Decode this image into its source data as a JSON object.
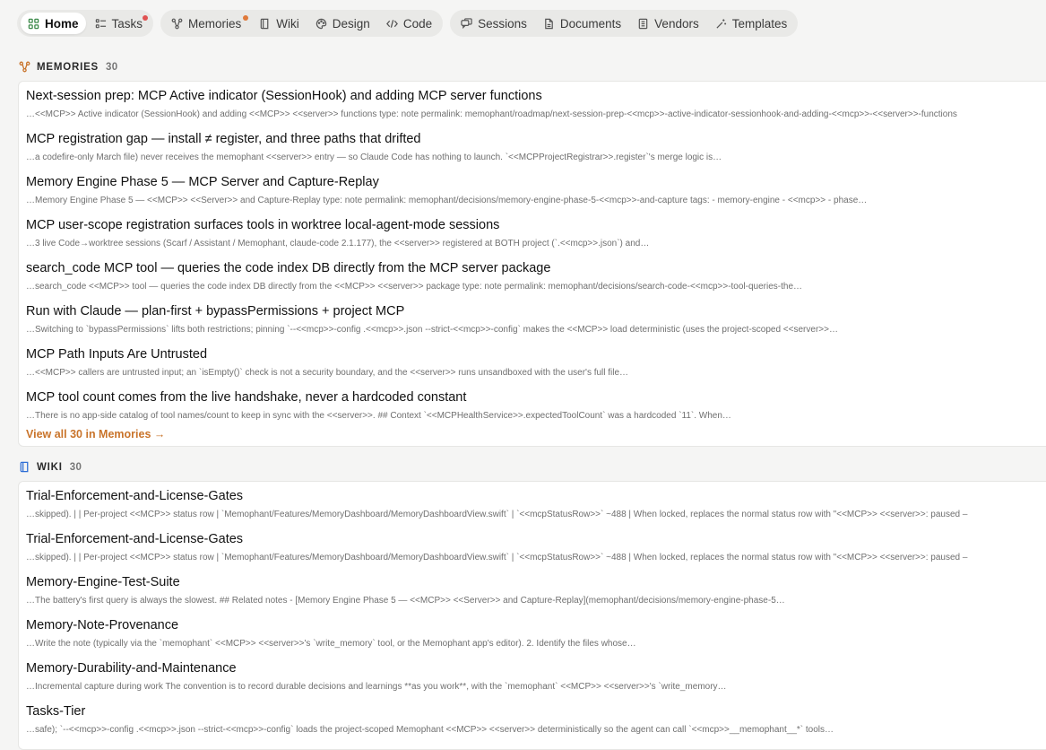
{
  "colors": {
    "accent": "#c9742b",
    "badge_red": "#e05252",
    "badge_orange": "#e07a3b",
    "wiki_icon": "#2f6fd6"
  },
  "nav": {
    "group1": [
      {
        "label": "Home",
        "icon": "grid-icon",
        "active": true
      },
      {
        "label": "Tasks",
        "icon": "list-icon",
        "badge": "red"
      }
    ],
    "group2": [
      {
        "label": "Memories",
        "icon": "nodes-icon",
        "badge": "orange"
      },
      {
        "label": "Wiki",
        "icon": "book-icon"
      },
      {
        "label": "Design",
        "icon": "palette-icon"
      },
      {
        "label": "Code",
        "icon": "code-icon"
      }
    ],
    "group3": [
      {
        "label": "Sessions",
        "icon": "chat-icon"
      },
      {
        "label": "Documents",
        "icon": "document-icon"
      },
      {
        "label": "Vendors",
        "icon": "building-icon"
      },
      {
        "label": "Templates",
        "icon": "wand-icon"
      }
    ]
  },
  "memories": {
    "heading": "MEMORIES",
    "count": "30",
    "items": [
      {
        "title": "Next-session prep: MCP Active indicator (SessionHook) and adding MCP server functions",
        "snippet": "…<<MCP>> Active indicator (SessionHook) and adding <<MCP>> <<server>> functions type: note permalink: memophant/roadmap/next-session-prep-<<mcp>>-active-indicator-sessionhook-and-adding-<<mcp>>-<<server>>-functions"
      },
      {
        "title": "MCP registration gap — install ≠ register, and three paths that drifted",
        "snippet": "…a codefire-only March file) never receives the memophant <<server>> entry — so Claude Code has nothing to launch. `<<MCPProjectRegistrar>>.register`'s merge logic is…"
      },
      {
        "title": "Memory Engine Phase 5 — MCP Server and Capture-Replay",
        "snippet": "…Memory Engine Phase 5 — <<MCP>> <<Server>> and Capture-Replay type: note permalink: memophant/decisions/memory-engine-phase-5-<<mcp>>-and-capture tags: - memory-engine - <<mcp>> - phase…"
      },
      {
        "title": "MCP user-scope registration surfaces tools in worktree local-agent-mode sessions",
        "snippet": "…3 live Code→worktree sessions (Scarf / Assistant / Memophant, claude-code 2.1.177), the <<server>> registered at BOTH project (`.<<mcp>>.json`) and…"
      },
      {
        "title": "search_code MCP tool — queries the code index DB directly from the MCP server package",
        "snippet": "…search_code <<MCP>> tool — queries the code index DB directly from the <<MCP>> <<server>> package type: note permalink: memophant/decisions/search-code-<<mcp>>-tool-queries-the…"
      },
      {
        "title": "Run with Claude — plan-first + bypassPermissions + project MCP",
        "snippet": "…Switching to `bypassPermissions` lifts both restrictions; pinning `--<<mcp>>-config .<<mcp>>.json --strict-<<mcp>>-config` makes the <<MCP>> load deterministic (uses the project-scoped <<server>>…"
      },
      {
        "title": "MCP Path Inputs Are Untrusted",
        "snippet": "…<<MCP>> callers are untrusted input; an `isEmpty()` check is not a security boundary, and the <<server>> runs unsandboxed with the user's full file…"
      },
      {
        "title": "MCP tool count comes from the live handshake, never a hardcoded constant",
        "snippet": "…There is no app-side catalog of tool names/count to keep in sync with the <<server>>.  ## Context  `<<MCPHealthService>>.expectedToolCount` was a hardcoded `11`. When…"
      }
    ],
    "view_all": "View all 30 in Memories →"
  },
  "wiki": {
    "heading": "WIKI",
    "count": "30",
    "items": [
      {
        "title": "Trial-Enforcement-and-License-Gates",
        "snippet": "…skipped). | | Per-project <<MCP>> status row | `Memophant/Features/MemoryDashboard/MemoryDashboardView.swift` | `<<mcpStatusRow>>` ~488 | When locked, replaces the normal status row with \"<<MCP>> <<server>>: paused –"
      },
      {
        "title": "Trial-Enforcement-and-License-Gates",
        "snippet": "…skipped). | | Per-project <<MCP>> status row | `Memophant/Features/MemoryDashboard/MemoryDashboardView.swift` | `<<mcpStatusRow>>` ~488 | When locked, replaces the normal status row with \"<<MCP>> <<server>>: paused –"
      },
      {
        "title": "Memory-Engine-Test-Suite",
        "snippet": "…The battery's first query is always the slowest.  ## Related notes  - [Memory Engine Phase 5 — <<MCP>> <<Server>> and Capture-Replay](memophant/decisions/memory-engine-phase-5…"
      },
      {
        "title": "Memory-Note-Provenance",
        "snippet": "…Write the note (typically via the `memophant` <<MCP>> <<server>>'s `write_memory` tool, or the Memophant app's editor). 2. Identify the files whose…"
      },
      {
        "title": "Memory-Durability-and-Maintenance",
        "snippet": "…Incremental capture during work  The convention is to record durable decisions and learnings **as you work**, with the `memophant` <<MCP>> <<server>>'s `write_memory…"
      },
      {
        "title": "Tasks-Tier",
        "snippet": "…safe); `--<<mcp>>-config .<<mcp>>.json --strict-<<mcp>>-config` loads the project-scoped Memophant <<MCP>> <<server>> deterministically so the agent can call `<<mcp>>__memophant__*` tools…"
      }
    ]
  }
}
